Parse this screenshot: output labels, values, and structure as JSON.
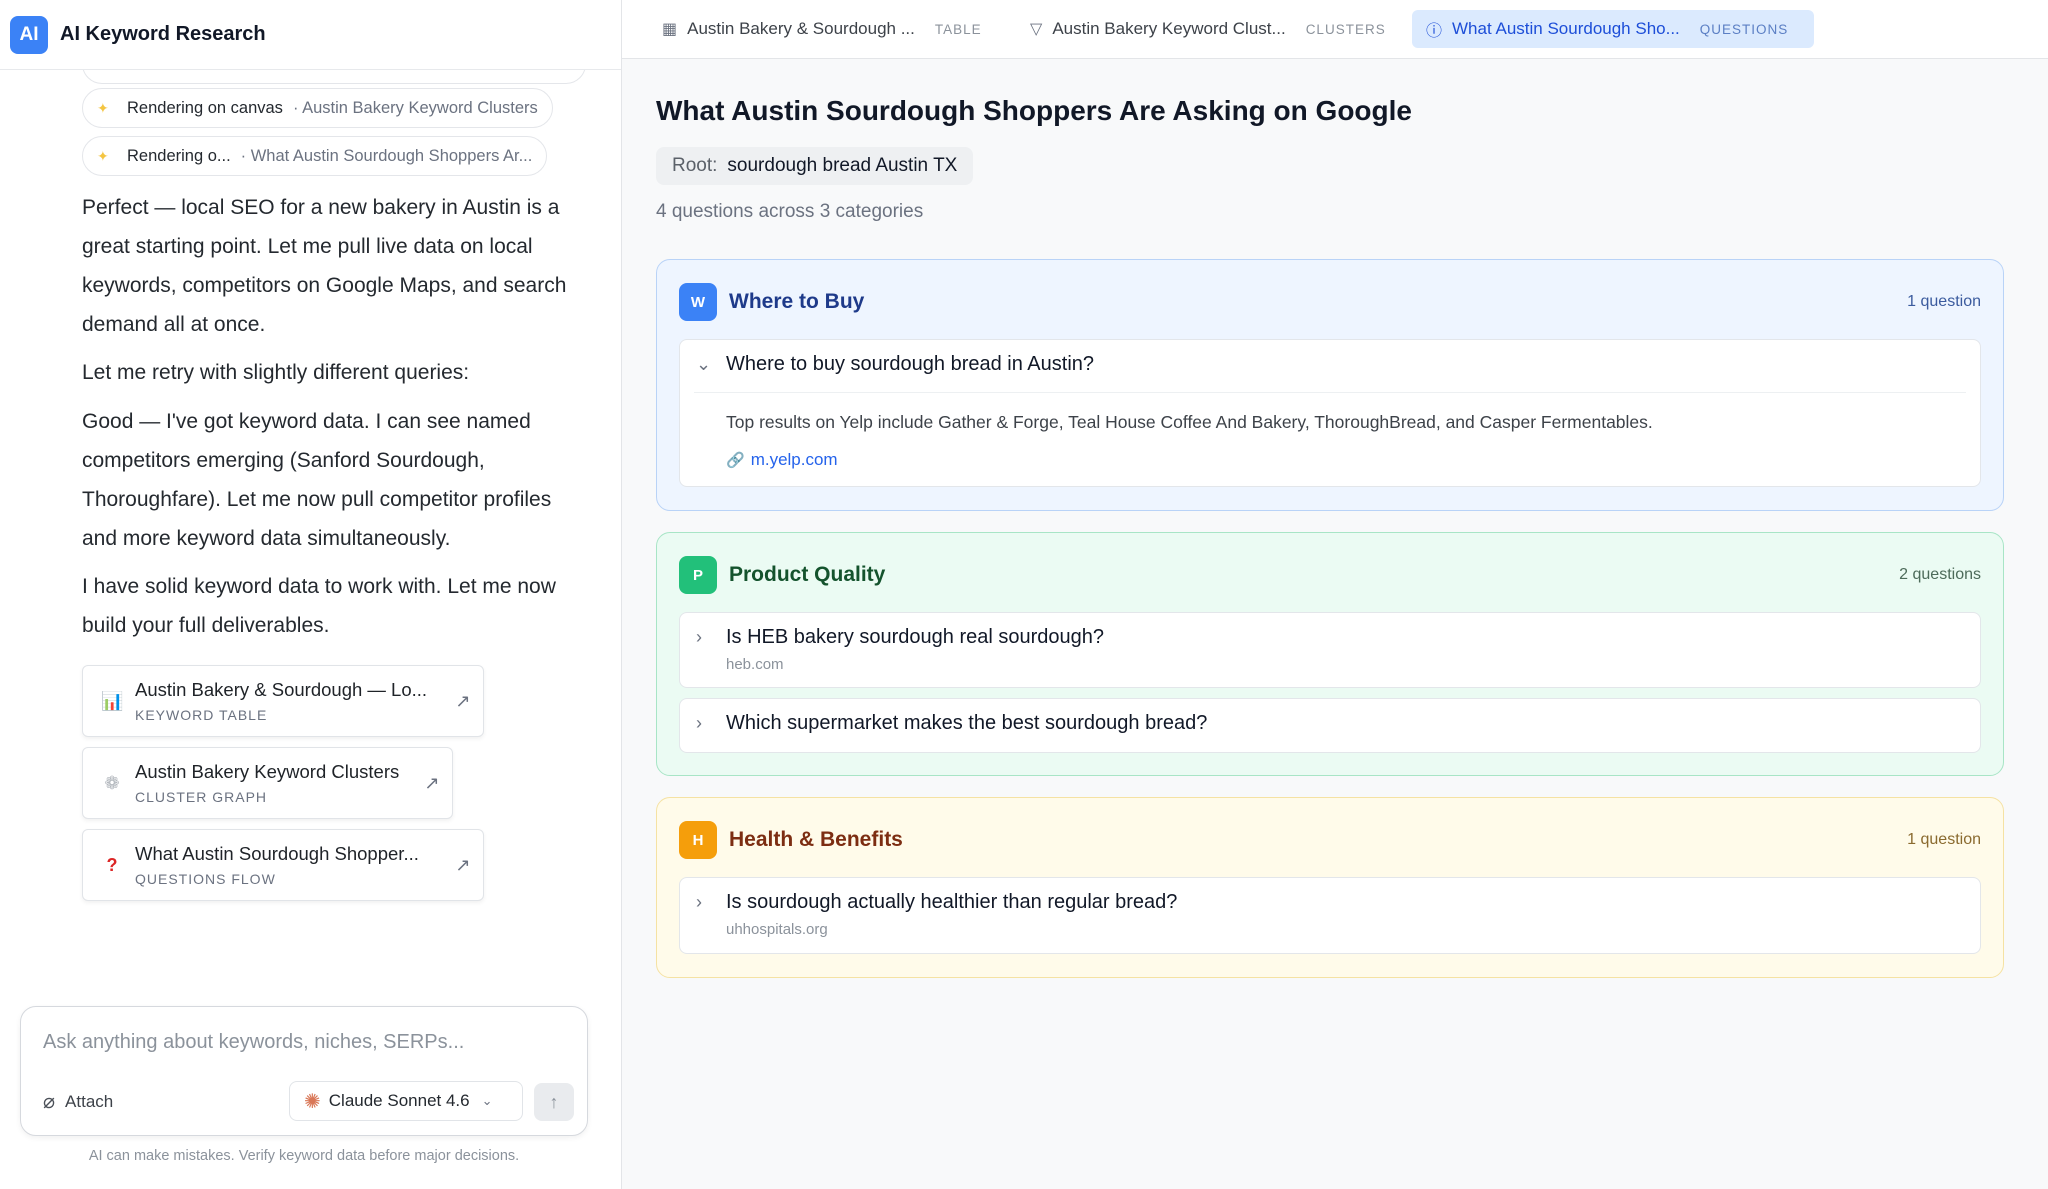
{
  "app": {
    "logo": "AI",
    "title": "AI Keyword Research"
  },
  "chat": {
    "statuses": [
      {
        "icon": "sparkle-icon",
        "label": "Rendering on canvas",
        "detail": "· Austin Bakery Keyword Clusters"
      },
      {
        "icon": "sparkle-icon",
        "label": "Rendering o...",
        "detail": "· What Austin Sourdough Shoppers Ar..."
      }
    ],
    "messages": [
      "Perfect — local SEO for a new bakery in Austin is a great starting point. Let me pull live data on local keywords, competitors on Google Maps, and search demand all at once.",
      "Let me retry with slightly different queries:",
      "Good — I've got keyword data. I can see named competitors emerging (Sanford Sourdough, Thoroughfare). Let me now pull competitor profiles and more keyword data simultaneously.",
      "I have solid keyword data to work with. Let me now build your full deliverables."
    ],
    "artifacts": [
      {
        "icon": "bar-chart-icon",
        "glyph": "📊",
        "title": "Austin Bakery & Sourdough — Lo...",
        "type": "KEYWORD TABLE"
      },
      {
        "icon": "cluster-graph-icon",
        "glyph": "❁",
        "title": "Austin Bakery Keyword Clusters",
        "type": "CLUSTER GRAPH"
      },
      {
        "icon": "question-mark-icon",
        "glyph": "?",
        "title": "What Austin Sourdough Shopper...",
        "type": "QUESTIONS FLOW"
      }
    ]
  },
  "composer": {
    "placeholder": "Ask anything about keywords, niches, SERPs...",
    "attach_label": "Attach",
    "model_label": "Claude Sonnet 4.6",
    "disclaimer": "AI can make mistakes. Verify keyword data before major decisions."
  },
  "tabs": [
    {
      "icon": "table-icon",
      "glyph": "▦",
      "label": "Austin Bakery & Sourdough ...",
      "type": "TABLE",
      "active": false
    },
    {
      "icon": "filter-icon",
      "glyph": "▽",
      "label": "Austin Bakery Keyword Clust...",
      "type": "CLUSTERS",
      "active": false
    },
    {
      "icon": "question-circle-icon",
      "glyph": "?",
      "label": "What Austin Sourdough Sho...",
      "type": "QUESTIONS",
      "active": true
    }
  ],
  "main": {
    "title": "What Austin Sourdough Shoppers Are Asking on Google",
    "root_label": "Root:",
    "root_value": "sourdough bread Austin TX",
    "summary": "4 questions across 3 categories",
    "categories": [
      {
        "badge": "W",
        "name": "Where to Buy",
        "count": "1 question",
        "color": "#3b82f6",
        "questions": [
          {
            "text": "Where to buy sourdough bread in Austin?",
            "expanded": true,
            "answer": "Top results on Yelp include Gather & Forge, Teal House Coffee And Bakery, ThoroughBread, and Casper Fermentables.",
            "source": "m.yelp.com"
          }
        ]
      },
      {
        "badge": "P",
        "name": "Product Quality",
        "count": "2 questions",
        "color": "#22c07a",
        "questions": [
          {
            "text": "Is HEB bakery sourdough real sourdough?",
            "expanded": false,
            "source": "heb.com"
          },
          {
            "text": "Which supermarket makes the best sourdough bread?",
            "expanded": false,
            "source": ""
          }
        ]
      },
      {
        "badge": "H",
        "name": "Health & Benefits",
        "count": "1 question",
        "color": "#f59e0b",
        "questions": [
          {
            "text": "Is sourdough actually healthier than regular bread?",
            "expanded": false,
            "source": "uhhospitals.org"
          }
        ]
      }
    ]
  }
}
